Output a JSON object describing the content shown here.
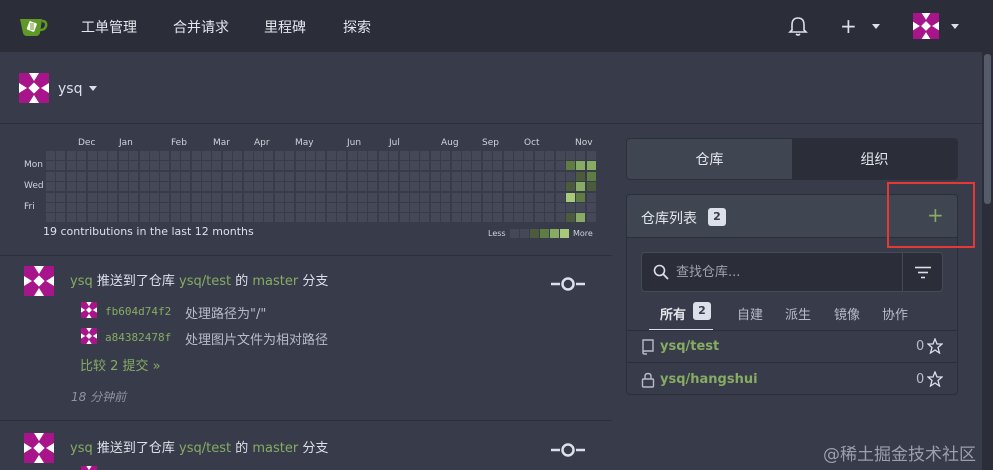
{
  "nav": {
    "items": [
      "工单管理",
      "合并请求",
      "里程碑",
      "探索"
    ],
    "plus_label": "+"
  },
  "user": {
    "name": "ysq"
  },
  "heatmap": {
    "months": [
      "Dec",
      "Jan",
      "Feb",
      "Mar",
      "Apr",
      "May",
      "Jun",
      "Jul",
      "Aug",
      "Sep",
      "Oct",
      "Nov"
    ],
    "days": [
      "Mon",
      "Wed",
      "Fri"
    ],
    "summary": "19 contributions in the last 12 months",
    "legend_less": "Less",
    "legend_more": "More",
    "colors": [
      "#444857",
      "#4d5b3d",
      "#5f7c43",
      "#87ab63",
      "#a6c97a"
    ]
  },
  "feed": [
    {
      "user": "ysq",
      "action_pre": "推送到了仓库",
      "repo": "ysq/test",
      "mid": "的",
      "branch": "master",
      "suffix": "分支",
      "commits": [
        {
          "sha": "fb604d74f2",
          "msg": "处理路径为\"/\""
        },
        {
          "sha": "a84382478f",
          "msg": "处理图片文件为相对路径"
        }
      ],
      "compare": "比较 2 提交 »",
      "time": "18 分钟前"
    },
    {
      "user": "ysq",
      "action_pre": "推送到了仓库",
      "repo": "ysq/test",
      "mid": "的",
      "branch": "master",
      "suffix": "分支"
    }
  ],
  "sidebar": {
    "tab_repos": "仓库",
    "tab_orgs": "组织",
    "panel_title": "仓库列表",
    "repo_count": "2",
    "add_label": "+",
    "search_placeholder": "查找仓库...",
    "subtabs": [
      "所有",
      "自建",
      "派生",
      "镜像",
      "协作"
    ],
    "all_count": "2",
    "repos": [
      {
        "name": "ysq/test",
        "stars": "0",
        "icon": "repo-icon"
      },
      {
        "name": "ysq/hangshui",
        "stars": "0",
        "icon": "lock-icon"
      }
    ]
  },
  "watermark": "@稀土掘金技术社区"
}
